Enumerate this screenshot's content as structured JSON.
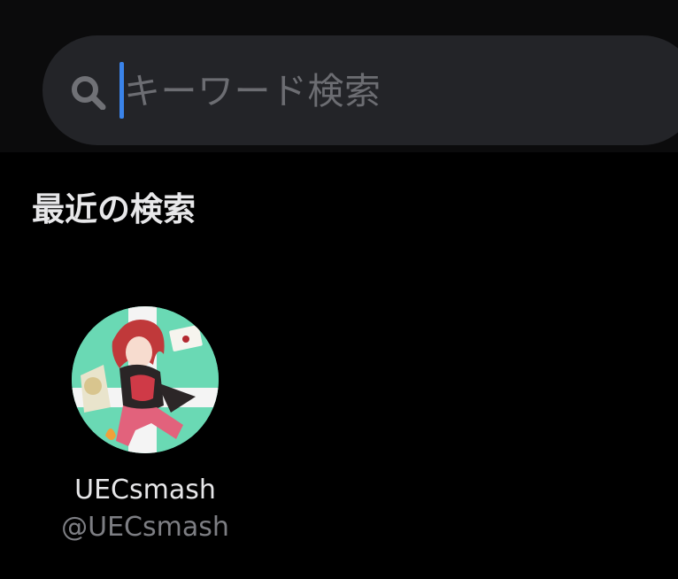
{
  "search": {
    "placeholder": "キーワード検索",
    "icon": "search-icon"
  },
  "recent": {
    "title": "最近の検索",
    "items": [
      {
        "display_name": "UECsmash",
        "handle": "@UECsmash",
        "avatar_icon": "avatar"
      }
    ]
  },
  "colors": {
    "background": "#000000",
    "search_field": "#232428",
    "caret": "#3a83e9",
    "placeholder_text": "#6c6d72",
    "primary_text": "#e6e6e8",
    "secondary_text": "#7d7e83",
    "avatar_bg": "#6ad9b4"
  }
}
